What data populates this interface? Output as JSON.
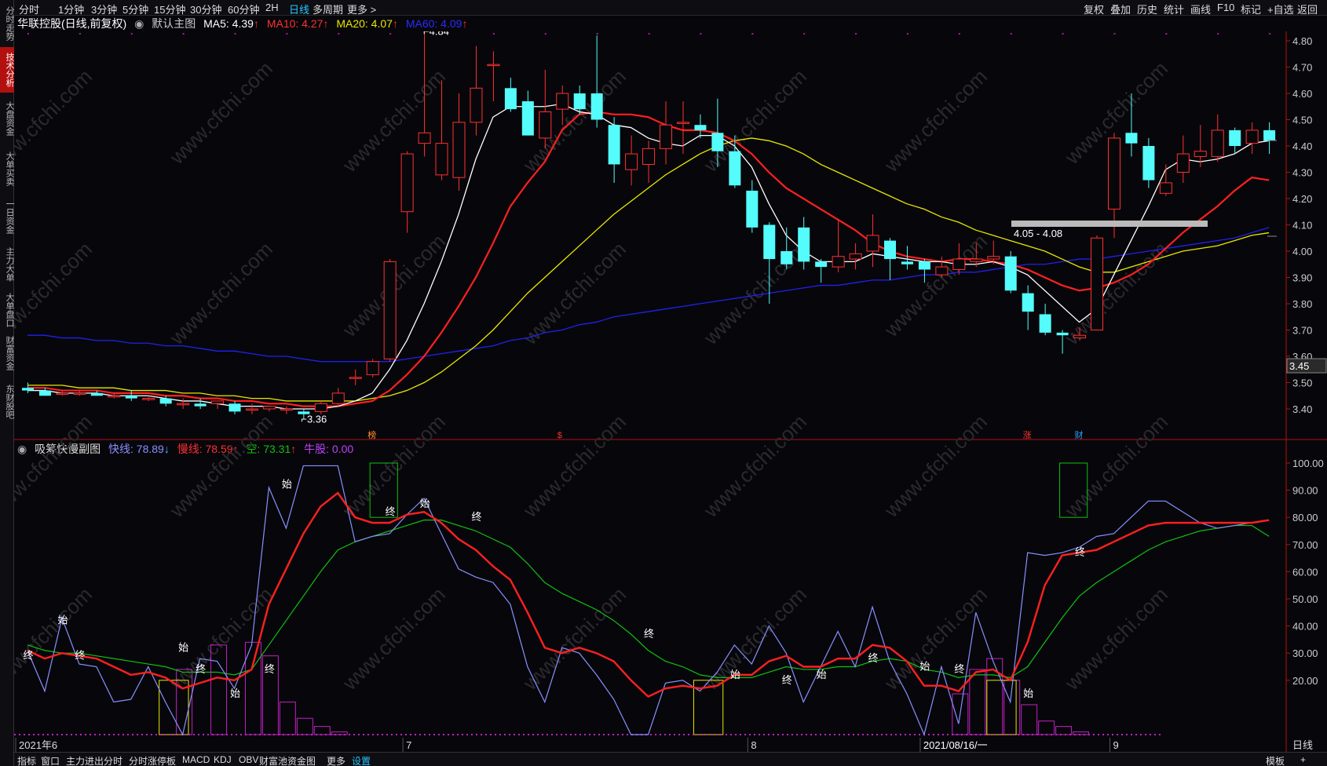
{
  "left_tabs": [
    {
      "label": "分时走势",
      "active": false
    },
    {
      "label": "技术分析",
      "active": true
    },
    {
      "label": "大盘资金",
      "active": false
    },
    {
      "label": "大单买卖",
      "active": false
    },
    {
      "label": "一日资金",
      "active": false
    },
    {
      "label": "主力大单",
      "active": false
    },
    {
      "label": "大单盘口",
      "active": false
    },
    {
      "label": "财富资金",
      "active": false
    },
    {
      "label": "东财股吧",
      "active": false
    }
  ],
  "top_left_tabs": [
    "分时",
    "1分钟",
    "3分钟",
    "5分钟",
    "15分钟",
    "30分钟",
    "60分钟",
    "2H",
    "日线",
    "多周期",
    "更多 >"
  ],
  "top_selected": "日线",
  "top_right_tabs": [
    "复权",
    "叠加",
    "历史",
    "统计",
    "画线",
    "F10",
    "标记",
    "+自选",
    "返回"
  ],
  "title": {
    "stock": "华联控股(日线,前复权)",
    "main_label": "默认主图",
    "ma5": "MA5: 4.39",
    "ma10": "MA10: 4.27",
    "ma20": "MA20: 4.07",
    "ma60": "MA60: 4.09"
  },
  "subtitle": {
    "name": "吸筹快慢副图",
    "fast": "快线: 78.89",
    "slow": "慢线: 78.59",
    "empty": "空: 73.31",
    "bull": "牛股: 0.00"
  },
  "bottom_tabs": [
    "指标",
    "窗口",
    "主力进出分时",
    "分时涨停板",
    "MACD",
    "KDJ",
    "OBV",
    "财富池资金图",
    "更多",
    "设置"
  ],
  "bottom_selected": "设置",
  "bottom_right": [
    "模板",
    "+"
  ],
  "period_label": "日线",
  "watermark": "www.cfchi.com",
  "colors": {
    "up": "#ff3030",
    "down": "#54fcfc",
    "ma5": "#ffffff",
    "ma10": "#ff2020",
    "ma20": "#e8e800",
    "ma60": "#2020ee",
    "fast": "#8890ff",
    "slow": "#ff2020",
    "empty": "#10c010",
    "bull": "#c020c0",
    "yellow_box": "#e8e800",
    "green_box": "#10c010"
  },
  "chart_data": {
    "type": "candlestick",
    "main": {
      "y_ticks": [
        4.8,
        4.7,
        4.6,
        4.5,
        4.4,
        4.3,
        4.2,
        4.1,
        4.0,
        3.9,
        3.8,
        3.7,
        3.6,
        3.5,
        3.4
      ],
      "ylim": [
        3.35,
        4.85
      ],
      "candles": [
        {
          "o": 3.48,
          "h": 3.5,
          "l": 3.46,
          "c": 3.47
        },
        {
          "o": 3.47,
          "h": 3.48,
          "l": 3.45,
          "c": 3.45
        },
        {
          "o": 3.46,
          "h": 3.47,
          "l": 3.45,
          "c": 3.46
        },
        {
          "o": 3.46,
          "h": 3.47,
          "l": 3.45,
          "c": 3.46
        },
        {
          "o": 3.46,
          "h": 3.47,
          "l": 3.45,
          "c": 3.45
        },
        {
          "o": 3.45,
          "h": 3.46,
          "l": 3.44,
          "c": 3.45
        },
        {
          "o": 3.45,
          "h": 3.47,
          "l": 3.43,
          "c": 3.44
        },
        {
          "o": 3.44,
          "h": 3.45,
          "l": 3.43,
          "c": 3.44
        },
        {
          "o": 3.44,
          "h": 3.45,
          "l": 3.41,
          "c": 3.42
        },
        {
          "o": 3.42,
          "h": 3.44,
          "l": 3.4,
          "c": 3.42
        },
        {
          "o": 3.42,
          "h": 3.44,
          "l": 3.4,
          "c": 3.41
        },
        {
          "o": 3.42,
          "h": 3.43,
          "l": 3.4,
          "c": 3.43
        },
        {
          "o": 3.42,
          "h": 3.43,
          "l": 3.38,
          "c": 3.39
        },
        {
          "o": 3.4,
          "h": 3.42,
          "l": 3.38,
          "c": 3.4
        },
        {
          "o": 3.4,
          "h": 3.41,
          "l": 3.39,
          "c": 3.41
        },
        {
          "o": 3.4,
          "h": 3.41,
          "l": 3.38,
          "c": 3.4
        },
        {
          "o": 3.39,
          "h": 3.4,
          "l": 3.36,
          "c": 3.38
        },
        {
          "o": 3.39,
          "h": 3.43,
          "l": 3.38,
          "c": 3.42
        },
        {
          "o": 3.42,
          "h": 3.48,
          "l": 3.41,
          "c": 3.46
        },
        {
          "o": 3.52,
          "h": 3.55,
          "l": 3.49,
          "c": 3.52
        },
        {
          "o": 3.53,
          "h": 3.59,
          "l": 3.52,
          "c": 3.58
        },
        {
          "o": 3.59,
          "h": 3.97,
          "l": 3.58,
          "c": 3.96
        },
        {
          "o": 4.15,
          "h": 4.38,
          "l": 4.07,
          "c": 4.37
        },
        {
          "o": 4.41,
          "h": 4.84,
          "l": 4.36,
          "c": 4.45
        },
        {
          "o": 4.29,
          "h": 4.65,
          "l": 4.27,
          "c": 4.41
        },
        {
          "o": 4.28,
          "h": 4.6,
          "l": 4.23,
          "c": 4.49
        },
        {
          "o": 4.49,
          "h": 4.78,
          "l": 4.44,
          "c": 4.62
        },
        {
          "o": 4.71,
          "h": 4.76,
          "l": 4.57,
          "c": 4.71
        },
        {
          "o": 4.62,
          "h": 4.66,
          "l": 4.53,
          "c": 4.54
        },
        {
          "o": 4.57,
          "h": 4.61,
          "l": 4.44,
          "c": 4.44
        },
        {
          "o": 4.43,
          "h": 4.69,
          "l": 4.39,
          "c": 4.53
        },
        {
          "o": 4.54,
          "h": 4.63,
          "l": 4.48,
          "c": 4.6
        },
        {
          "o": 4.6,
          "h": 4.63,
          "l": 4.52,
          "c": 4.54
        },
        {
          "o": 4.6,
          "h": 4.82,
          "l": 4.47,
          "c": 4.5
        },
        {
          "o": 4.48,
          "h": 4.51,
          "l": 4.26,
          "c": 4.33
        },
        {
          "o": 4.31,
          "h": 4.44,
          "l": 4.25,
          "c": 4.37
        },
        {
          "o": 4.33,
          "h": 4.42,
          "l": 4.26,
          "c": 4.39
        },
        {
          "o": 4.39,
          "h": 4.57,
          "l": 4.33,
          "c": 4.48
        },
        {
          "o": 4.49,
          "h": 4.57,
          "l": 4.37,
          "c": 4.49
        },
        {
          "o": 4.48,
          "h": 4.52,
          "l": 4.43,
          "c": 4.46
        },
        {
          "o": 4.45,
          "h": 4.58,
          "l": 4.32,
          "c": 4.38
        },
        {
          "o": 4.38,
          "h": 4.44,
          "l": 4.24,
          "c": 4.25
        },
        {
          "o": 4.23,
          "h": 4.27,
          "l": 4.07,
          "c": 4.09
        },
        {
          "o": 4.1,
          "h": 4.11,
          "l": 3.8,
          "c": 3.97
        },
        {
          "o": 4.0,
          "h": 4.09,
          "l": 3.93,
          "c": 3.95
        },
        {
          "o": 4.09,
          "h": 4.13,
          "l": 3.93,
          "c": 3.96
        },
        {
          "o": 3.96,
          "h": 3.97,
          "l": 3.88,
          "c": 3.94
        },
        {
          "o": 3.94,
          "h": 4.12,
          "l": 3.92,
          "c": 3.98
        },
        {
          "o": 3.97,
          "h": 4.03,
          "l": 3.93,
          "c": 3.99
        },
        {
          "o": 4.0,
          "h": 4.14,
          "l": 3.94,
          "c": 4.06
        },
        {
          "o": 4.04,
          "h": 4.05,
          "l": 3.89,
          "c": 3.97
        },
        {
          "o": 3.96,
          "h": 4.02,
          "l": 3.93,
          "c": 3.95
        },
        {
          "o": 3.96,
          "h": 3.97,
          "l": 3.88,
          "c": 3.93
        },
        {
          "o": 3.91,
          "h": 3.98,
          "l": 3.9,
          "c": 3.94
        },
        {
          "o": 3.93,
          "h": 4.03,
          "l": 3.91,
          "c": 3.97
        },
        {
          "o": 3.96,
          "h": 4.03,
          "l": 3.94,
          "c": 3.97
        },
        {
          "o": 3.97,
          "h": 4.04,
          "l": 3.95,
          "c": 3.98
        },
        {
          "o": 3.98,
          "h": 4.0,
          "l": 3.84,
          "c": 3.85
        },
        {
          "o": 3.84,
          "h": 3.87,
          "l": 3.7,
          "c": 3.77
        },
        {
          "o": 3.76,
          "h": 3.8,
          "l": 3.68,
          "c": 3.69
        },
        {
          "o": 3.69,
          "h": 3.7,
          "l": 3.61,
          "c": 3.68
        },
        {
          "o": 3.67,
          "h": 3.71,
          "l": 3.66,
          "c": 3.68
        },
        {
          "o": 3.7,
          "h": 4.06,
          "l": 3.7,
          "c": 4.05
        },
        {
          "o": 4.16,
          "h": 4.45,
          "l": 4.05,
          "c": 4.43
        },
        {
          "o": 4.45,
          "h": 4.6,
          "l": 4.36,
          "c": 4.41
        },
        {
          "o": 4.4,
          "h": 4.43,
          "l": 4.24,
          "c": 4.27
        },
        {
          "o": 4.22,
          "h": 4.33,
          "l": 4.21,
          "c": 4.26
        },
        {
          "o": 4.3,
          "h": 4.44,
          "l": 4.26,
          "c": 4.37
        },
        {
          "o": 4.36,
          "h": 4.48,
          "l": 4.32,
          "c": 4.38
        },
        {
          "o": 4.36,
          "h": 4.52,
          "l": 4.34,
          "c": 4.46
        },
        {
          "o": 4.46,
          "h": 4.47,
          "l": 4.37,
          "c": 4.4
        },
        {
          "o": 4.41,
          "h": 4.49,
          "l": 4.37,
          "c": 4.46
        },
        {
          "o": 4.46,
          "h": 4.49,
          "l": 4.37,
          "c": 4.42
        }
      ],
      "ma5": [
        3.47,
        3.47,
        3.46,
        3.46,
        3.46,
        3.45,
        3.45,
        3.45,
        3.44,
        3.43,
        3.43,
        3.42,
        3.41,
        3.41,
        3.41,
        3.4,
        3.4,
        3.4,
        3.41,
        3.43,
        3.46,
        3.55,
        3.66,
        3.8,
        3.96,
        4.14,
        4.35,
        4.51,
        4.55,
        4.55,
        4.55,
        4.56,
        4.53,
        4.52,
        4.48,
        4.47,
        4.43,
        4.41,
        4.4,
        4.44,
        4.44,
        4.4,
        4.32,
        4.18,
        4.06,
        4.0,
        3.96,
        3.96,
        3.96,
        3.99,
        3.98,
        3.97,
        3.96,
        3.96,
        3.95,
        3.95,
        3.96,
        3.94,
        3.91,
        3.85,
        3.79,
        3.73,
        3.78,
        3.91,
        4.04,
        4.17,
        4.31,
        4.35,
        4.34,
        4.35,
        4.37,
        4.41,
        4.42
      ],
      "ma10": [
        3.48,
        3.48,
        3.47,
        3.47,
        3.47,
        3.46,
        3.46,
        3.46,
        3.45,
        3.45,
        3.44,
        3.44,
        3.43,
        3.43,
        3.42,
        3.42,
        3.41,
        3.41,
        3.41,
        3.42,
        3.43,
        3.47,
        3.53,
        3.6,
        3.69,
        3.79,
        3.9,
        4.03,
        4.17,
        4.26,
        4.34,
        4.46,
        4.52,
        4.53,
        4.52,
        4.52,
        4.51,
        4.48,
        4.46,
        4.46,
        4.45,
        4.42,
        4.37,
        4.3,
        4.24,
        4.2,
        4.16,
        4.12,
        4.08,
        4.03,
        4.0,
        3.98,
        3.97,
        3.96,
        3.97,
        3.97,
        3.96,
        3.95,
        3.93,
        3.9,
        3.87,
        3.85,
        3.86,
        3.88,
        3.91,
        3.95,
        4.01,
        4.07,
        4.12,
        4.17,
        4.23,
        4.28,
        4.27
      ],
      "ma20": [
        3.49,
        3.49,
        3.49,
        3.48,
        3.48,
        3.48,
        3.47,
        3.47,
        3.47,
        3.46,
        3.46,
        3.45,
        3.45,
        3.44,
        3.44,
        3.43,
        3.43,
        3.43,
        3.43,
        3.43,
        3.44,
        3.45,
        3.47,
        3.5,
        3.54,
        3.59,
        3.64,
        3.7,
        3.77,
        3.84,
        3.9,
        3.96,
        4.02,
        4.08,
        4.14,
        4.19,
        4.24,
        4.29,
        4.33,
        4.37,
        4.4,
        4.42,
        4.43,
        4.42,
        4.4,
        4.37,
        4.33,
        4.3,
        4.27,
        4.24,
        4.21,
        4.18,
        4.16,
        4.13,
        4.11,
        4.08,
        4.06,
        4.04,
        4.02,
        4.0,
        3.97,
        3.94,
        3.92,
        3.92,
        3.94,
        3.96,
        3.98,
        4.0,
        4.01,
        4.02,
        4.04,
        4.06,
        4.07
      ],
      "ma60": [
        3.68,
        3.68,
        3.67,
        3.67,
        3.66,
        3.66,
        3.65,
        3.65,
        3.64,
        3.64,
        3.63,
        3.62,
        3.62,
        3.61,
        3.6,
        3.6,
        3.59,
        3.58,
        3.58,
        3.58,
        3.58,
        3.58,
        3.59,
        3.6,
        3.61,
        3.62,
        3.63,
        3.64,
        3.66,
        3.67,
        3.69,
        3.7,
        3.72,
        3.73,
        3.75,
        3.76,
        3.77,
        3.78,
        3.79,
        3.8,
        3.81,
        3.82,
        3.83,
        3.84,
        3.85,
        3.86,
        3.87,
        3.87,
        3.88,
        3.89,
        3.89,
        3.9,
        3.91,
        3.91,
        3.92,
        3.92,
        3.93,
        3.94,
        3.95,
        3.95,
        3.96,
        3.97,
        3.97,
        3.98,
        3.99,
        4.0,
        4.01,
        4.02,
        4.03,
        4.04,
        4.05,
        4.07,
        4.09
      ],
      "annotations": [
        {
          "label": "4.84"
        },
        {
          "label": "3.36"
        }
      ],
      "range_label": "4.05 - 4.08",
      "price_label": "3.45",
      "markers": [
        "榜",
        "$",
        "涨",
        "财"
      ]
    },
    "sub": {
      "y_ticks": [
        100.0,
        90.0,
        80.0,
        70.0,
        60.0,
        50.0,
        40.0,
        30.0,
        20.0
      ],
      "ylim": [
        0,
        100
      ],
      "fast": [
        31,
        16,
        43,
        26,
        25,
        12,
        13,
        25,
        12,
        0,
        28,
        27,
        17,
        33,
        91,
        76,
        99,
        99,
        99,
        71,
        73,
        74,
        81,
        87,
        74,
        61,
        58,
        56,
        48,
        25,
        12,
        32,
        30,
        22,
        13,
        0,
        0,
        19,
        20,
        16,
        23,
        33,
        26,
        40,
        30,
        12,
        25,
        38,
        25,
        47,
        27,
        15,
        0,
        25,
        4,
        45,
        27,
        12,
        67,
        66,
        67,
        69,
        73,
        74,
        80,
        86,
        86,
        82,
        78,
        76,
        77,
        78,
        79
      ],
      "slow": [
        31,
        28,
        30,
        29,
        28,
        25,
        22,
        23,
        21,
        17,
        19,
        21,
        20,
        24,
        48,
        61,
        74,
        84,
        89,
        80,
        78,
        78,
        81,
        82,
        78,
        72,
        68,
        62,
        57,
        45,
        32,
        30,
        32,
        30,
        27,
        20,
        14,
        17,
        18,
        17,
        18,
        22,
        22,
        27,
        29,
        25,
        25,
        28,
        28,
        33,
        32,
        27,
        18,
        18,
        16,
        23,
        24,
        20,
        34,
        55,
        66,
        67,
        68,
        71,
        74,
        77,
        78,
        78,
        78,
        78,
        78,
        78,
        79
      ],
      "empty": [
        33,
        31,
        30,
        30,
        29,
        28,
        27,
        26,
        25,
        23,
        23,
        23,
        22,
        24,
        33,
        42,
        51,
        60,
        68,
        71,
        73,
        75,
        77,
        79,
        79,
        77,
        75,
        72,
        69,
        63,
        56,
        52,
        49,
        46,
        42,
        37,
        31,
        27,
        25,
        22,
        21,
        21,
        21,
        23,
        25,
        24,
        24,
        25,
        25,
        27,
        28,
        27,
        24,
        23,
        21,
        22,
        22,
        21,
        25,
        34,
        43,
        51,
        56,
        60,
        64,
        68,
        71,
        73,
        75,
        76,
        77,
        77,
        73
      ],
      "bull_bars": [
        0,
        0,
        0,
        0,
        0,
        0,
        0,
        0,
        0,
        24,
        0,
        33,
        0,
        34,
        29,
        12,
        6,
        3,
        1,
        0,
        0,
        0,
        0,
        0,
        0,
        0,
        0,
        0,
        0,
        0,
        0,
        0,
        0,
        0,
        0,
        0,
        0,
        0,
        0,
        0,
        0,
        0,
        0,
        0,
        0,
        0,
        0,
        0,
        0,
        0,
        0,
        0,
        0,
        0,
        15,
        24,
        28,
        20,
        11,
        5,
        3,
        1,
        0,
        0,
        0,
        0,
        0,
        0,
        0,
        0,
        0,
        0,
        0
      ],
      "labels_start": [
        "始",
        "始",
        "始",
        "始",
        "始",
        "始",
        "始",
        "始",
        "始"
      ],
      "labels_end": [
        "终",
        "终",
        "终",
        "终",
        "终",
        "终",
        "终",
        "终",
        "终",
        "终"
      ],
      "x_labels": [
        "2021年6",
        "7",
        "8",
        "2021/08/16/一",
        "9"
      ]
    }
  }
}
